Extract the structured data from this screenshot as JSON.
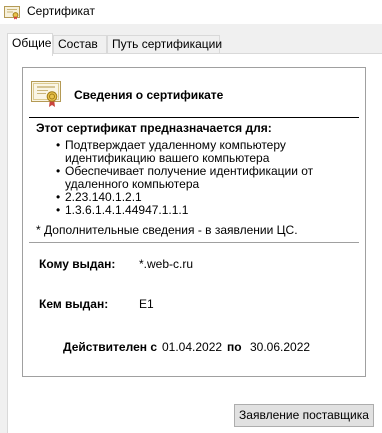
{
  "window": {
    "title": "Сертификат",
    "icon": "certificate-icon"
  },
  "tabs": [
    {
      "label": "Общие",
      "active": true
    },
    {
      "label": "Состав",
      "active": false
    },
    {
      "label": "Путь сертификации",
      "active": false
    }
  ],
  "info": {
    "icon": "certificate-icon",
    "title": "Сведения о сертификате",
    "purpose_heading": "Этот сертификат предназначается для:",
    "purposes": [
      "Подтверждает удаленному компьютеру идентификацию вашего компьютера",
      "Обеспечивает получение идентификации от удаленного компьютера",
      "2.23.140.1.2.1",
      "1.3.6.1.4.1.44947.1.1.1"
    ],
    "footnote": "* Дополнительные сведения - в заявлении ЦС.",
    "issued_to_label": "Кому выдан:",
    "issued_to_value": "*.web-c.ru",
    "issued_by_label": "Кем выдан:",
    "issued_by_value": "E1",
    "valid_from_label": "Действителен с",
    "valid_from_value": "01.04.2022",
    "valid_to_label": "по",
    "valid_to_value": "30.06.2022"
  },
  "buttons": {
    "issuer_statement": "Заявление поставщика"
  }
}
